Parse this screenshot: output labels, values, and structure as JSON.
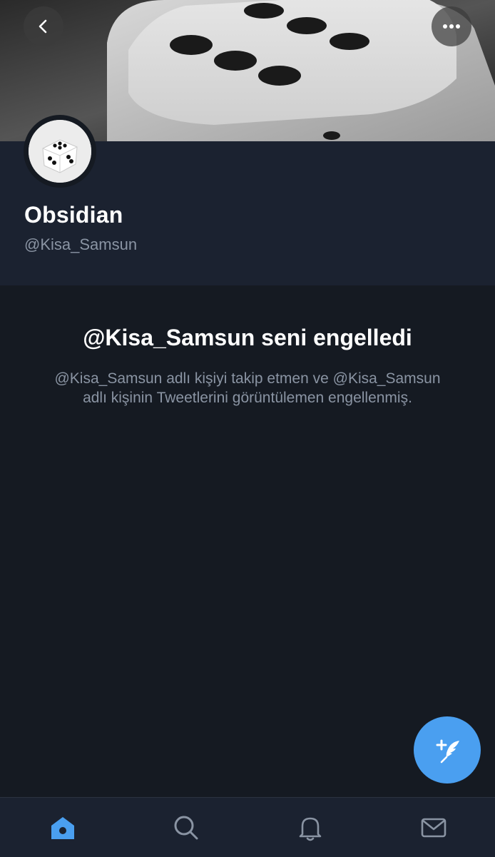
{
  "profile": {
    "display_name": "Obsidian",
    "handle": "@Kisa_Samsun"
  },
  "blocked": {
    "title": "@Kisa_Samsun seni engelledi",
    "description": "@Kisa_Samsun adlı kişiyi takip etmen ve @Kisa_Samsun adlı kişinin Tweetlerini görüntülemen engellenmiş."
  },
  "icons": {
    "back": "chevron-left-icon",
    "more": "ellipsis-icon",
    "compose": "compose-tweet-icon",
    "nav": [
      "home-icon",
      "search-icon",
      "bell-icon",
      "mail-icon"
    ]
  },
  "colors": {
    "accent": "#4a9ff0",
    "background": "#151a22",
    "profile_background": "#1b2230",
    "secondary_text": "#8a94a3"
  }
}
